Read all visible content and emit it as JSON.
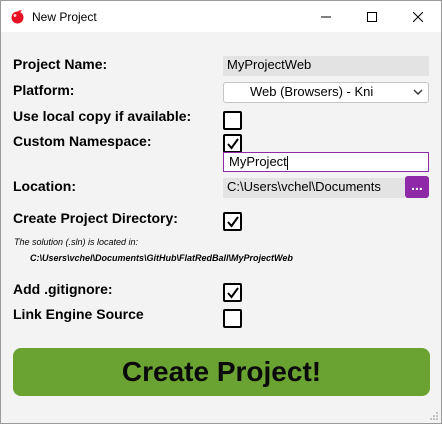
{
  "window": {
    "title": "New Project"
  },
  "colors": {
    "accent": "#8e2aa8",
    "create_button": "#6aa332",
    "field_bg": "#e3e3e3"
  },
  "icons": {
    "app": "red-apple-icon",
    "minimize": "minimize-icon",
    "maximize": "maximize-icon",
    "close": "close-icon"
  },
  "form": {
    "project_name_label": "Project Name:",
    "project_name_value": "MyProjectWeb",
    "platform_label": "Platform:",
    "platform_value": "Web (Browsers) - Kni",
    "use_local_copy_label": "Use local copy if available:",
    "use_local_copy_checked": false,
    "custom_namespace_label": "Custom Namespace:",
    "custom_namespace_checked": true,
    "namespace_value": "MyProject",
    "location_label": "Location:",
    "location_value": "C:\\Users\\vchel\\Documents",
    "browse_label": "...",
    "create_dir_label": "Create Project Directory:",
    "create_dir_checked": true,
    "solution_note": "The solution (.sln) is located in:",
    "solution_path": "C:\\Users\\vchel\\Documents\\GitHub\\FlatRedBall\\MyProjectWeb",
    "gitignore_label": "Add .gitignore:",
    "gitignore_checked": true,
    "link_engine_label": "Link Engine Source",
    "link_engine_checked": false
  },
  "create_button": {
    "label": "Create Project!"
  }
}
